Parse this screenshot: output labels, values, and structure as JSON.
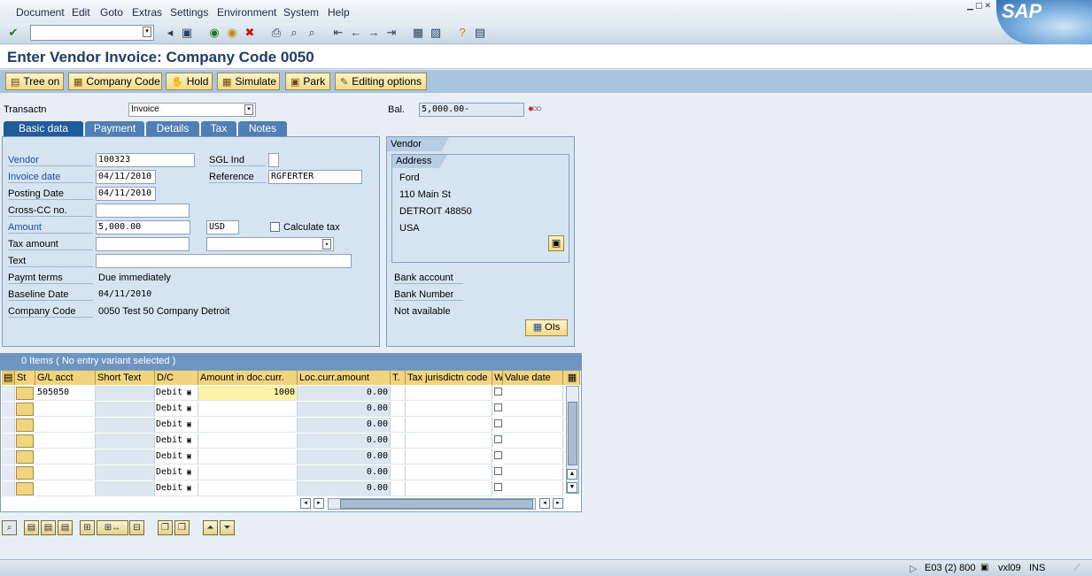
{
  "menu": [
    "Document",
    "Edit",
    "Goto",
    "Extras",
    "Settings",
    "Environment",
    "System",
    "Help"
  ],
  "logo_text": "SAP",
  "title": "Enter Vendor Invoice: Company Code 0050",
  "app_toolbar": [
    "Tree on",
    "Company Code",
    "Hold",
    "Simulate",
    "Park",
    "Editing options"
  ],
  "transaction": {
    "label": "Transactn",
    "value": "Invoice"
  },
  "balance": {
    "label": "Bal.",
    "value": "5,000.00-"
  },
  "tabs": [
    "Basic data",
    "Payment",
    "Details",
    "Tax",
    "Notes"
  ],
  "basic": {
    "vendor_label": "Vendor",
    "vendor": "100323",
    "sgl_label": "SGL Ind",
    "invoice_date_label": "Invoice date",
    "invoice_date": "04/11/2010",
    "reference_label": "Reference",
    "reference": "RGFERTER",
    "posting_date_label": "Posting Date",
    "posting_date": "04/11/2010",
    "cross_cc_label": "Cross-CC no.",
    "amount_label": "Amount",
    "amount": "5,000.00",
    "currency": "USD",
    "calc_tax_label": "Calculate tax",
    "tax_amount_label": "Tax amount",
    "text_label": "Text",
    "paymt_terms_label": "Paymt terms",
    "paymt_terms": "Due immediately",
    "baseline_label": "Baseline Date",
    "baseline": "04/11/2010",
    "company_code_label": "Company Code",
    "company_code": "0050 Test 50 Company Detroit"
  },
  "vendor": {
    "header": "Vendor",
    "address_header": "Address",
    "address_lines": [
      "Ford",
      "110 Main St",
      "DETROIT  48850",
      "USA"
    ],
    "bank_account_label": "Bank account",
    "bank_number_label": "Bank Number",
    "not_available": "Not available",
    "ois_label": "OIs"
  },
  "items": {
    "summary": "0 Items ( No entry variant selected )",
    "columns": [
      "St",
      "G/L acct",
      "Short Text",
      "D/C",
      "Amount in doc.curr.",
      "Loc.curr.amount",
      "T.",
      "Tax jurisdictn code",
      "W",
      "Value date"
    ],
    "rows": [
      {
        "gl": "505050",
        "dc": "Debit",
        "amount": "1000",
        "loc": "0.00"
      },
      {
        "gl": "",
        "dc": "Debit",
        "amount": "",
        "loc": "0.00"
      },
      {
        "gl": "",
        "dc": "Debit",
        "amount": "",
        "loc": "0.00"
      },
      {
        "gl": "",
        "dc": "Debit",
        "amount": "",
        "loc": "0.00"
      },
      {
        "gl": "",
        "dc": "Debit",
        "amount": "",
        "loc": "0.00"
      },
      {
        "gl": "",
        "dc": "Debit",
        "amount": "",
        "loc": "0.00"
      },
      {
        "gl": "",
        "dc": "Debit",
        "amount": "",
        "loc": "0.00"
      }
    ]
  },
  "status": {
    "session": "E03 (2) 800",
    "server": "vxl09",
    "mode": "INS"
  }
}
